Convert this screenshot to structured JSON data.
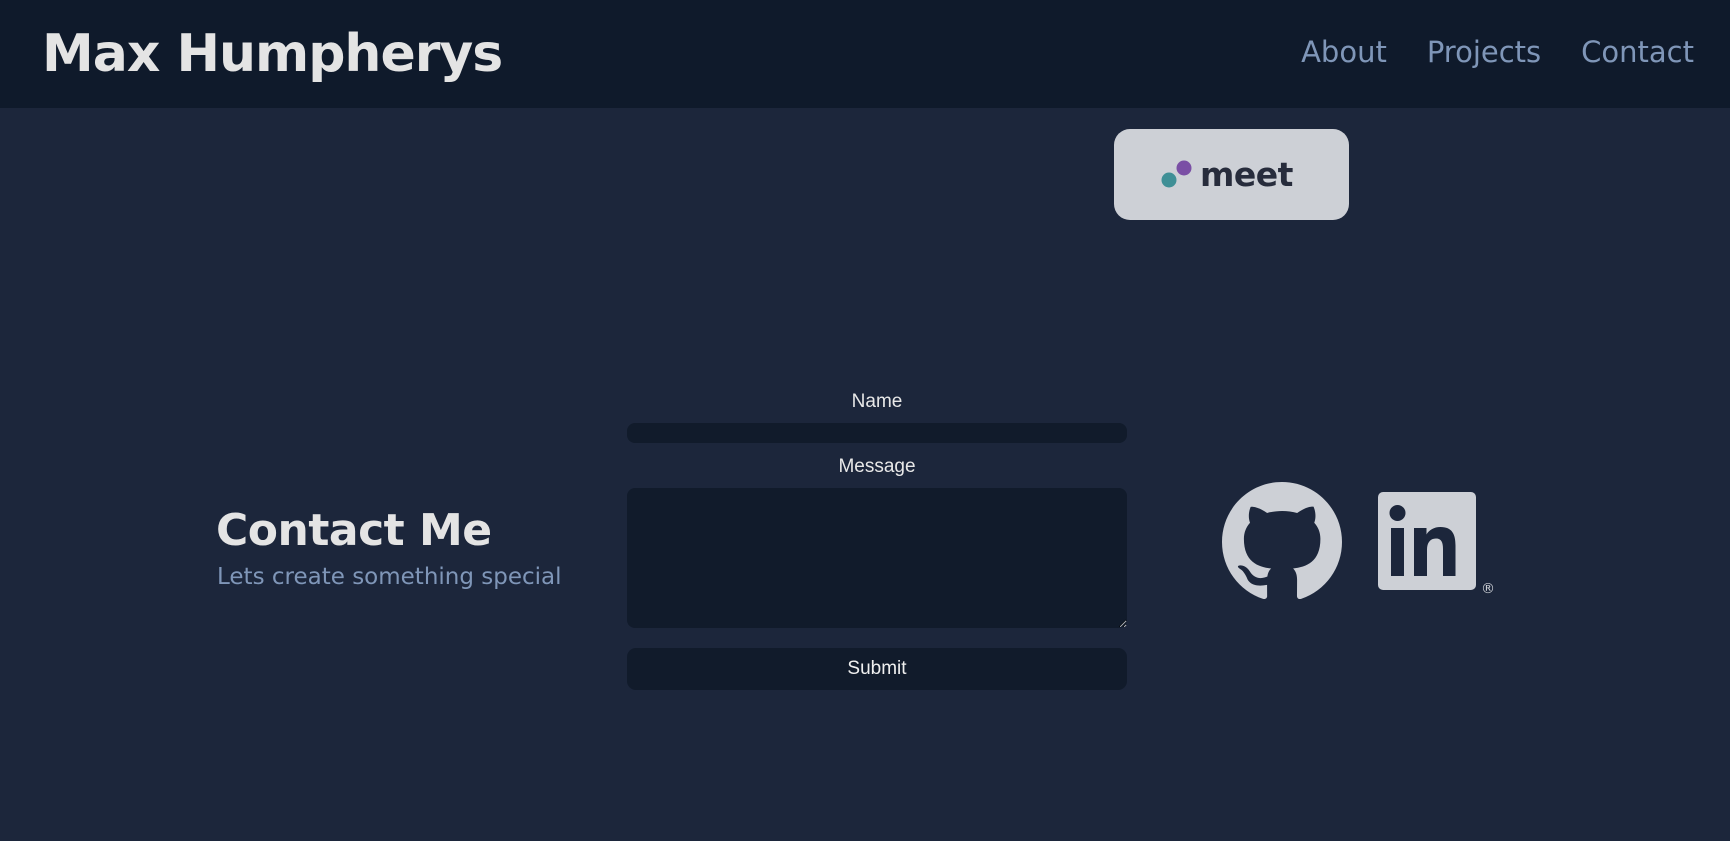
{
  "header": {
    "title": "Max Humpherys",
    "nav": [
      {
        "label": "About"
      },
      {
        "label": "Projects"
      },
      {
        "label": "Contact"
      }
    ]
  },
  "meet": {
    "label": "meet",
    "icon": "meet-logo-icon",
    "colors": {
      "purple": "#7a4fa5",
      "teal": "#3f8f96"
    }
  },
  "contact": {
    "heading": "Contact Me",
    "subheading": "Lets create something special"
  },
  "form": {
    "name_label": "Name",
    "name_value": "",
    "message_label": "Message",
    "message_value": "",
    "submit_label": "Submit"
  },
  "social": [
    {
      "name": "GitHub",
      "icon": "github-icon"
    },
    {
      "name": "LinkedIn",
      "icon": "linkedin-icon",
      "mark": "®"
    }
  ],
  "colors": {
    "background": "#1c263b",
    "header": "#0f1a2b",
    "accent": "#7f96b8",
    "heading_text": "#e4e4e4",
    "input_bg": "#111b2b",
    "icon": "#cdd0d6"
  }
}
